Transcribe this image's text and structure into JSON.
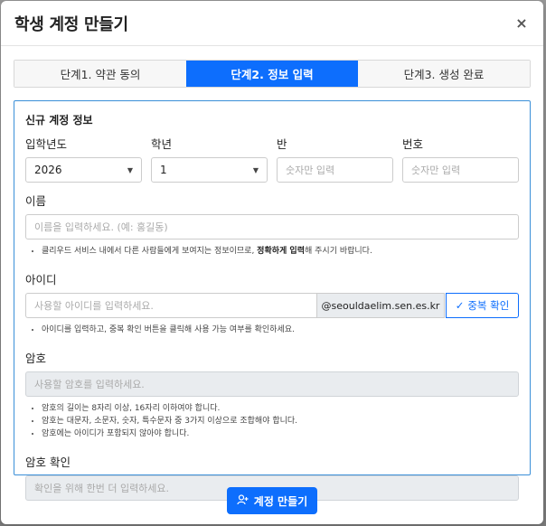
{
  "modal": {
    "title": "학생 계정 만들기",
    "close_label": "×"
  },
  "steps": [
    {
      "label": "단계1. 약관 동의",
      "active": false
    },
    {
      "label": "단계2. 정보 입력",
      "active": true
    },
    {
      "label": "단계3. 생성 완료",
      "active": false
    }
  ],
  "form": {
    "section_title": "신규 계정 정보",
    "year": {
      "label": "입학년도",
      "value": "2026"
    },
    "grade": {
      "label": "학년",
      "value": "1"
    },
    "class": {
      "label": "반",
      "placeholder": "숫자만 입력"
    },
    "number": {
      "label": "번호",
      "placeholder": "숫자만 입력"
    },
    "name": {
      "label": "이름",
      "placeholder": "이름을 입력하세요. (예: 홍길동)",
      "help_prefix": "클리우드 서비스 내에서 다른 사람들에게 보여지는 정보이므로, ",
      "help_bold": "정확하게 입력",
      "help_suffix": "해 주시기 바랍니다."
    },
    "id": {
      "label": "아이디",
      "placeholder": "사용할 아이디를 입력하세요.",
      "domain": "@seouldaelim.sen.es.kr",
      "check_label": "중복 확인",
      "help": "아이디를 입력하고, 중복 확인 버튼을 클릭해 사용 가능 여부를 확인하세요."
    },
    "password": {
      "label": "암호",
      "placeholder": "사용할 암호를 입력하세요.",
      "help": [
        "암호의 길이는 8자리 이상, 16자리 이하여야 합니다.",
        "암호는 대문자, 소문자, 숫자, 특수문자 중 3가지 이상으로 조합해야 합니다.",
        "암호에는 아이디가 포함되지 않아야 합니다."
      ]
    },
    "password_confirm": {
      "label": "암호 확인",
      "placeholder": "확인을 위해 한번 더 입력하세요."
    }
  },
  "footer": {
    "submit_label": "계정 만들기"
  },
  "colors": {
    "accent": "#0d6efd",
    "border_focus": "#3a8fd8"
  }
}
